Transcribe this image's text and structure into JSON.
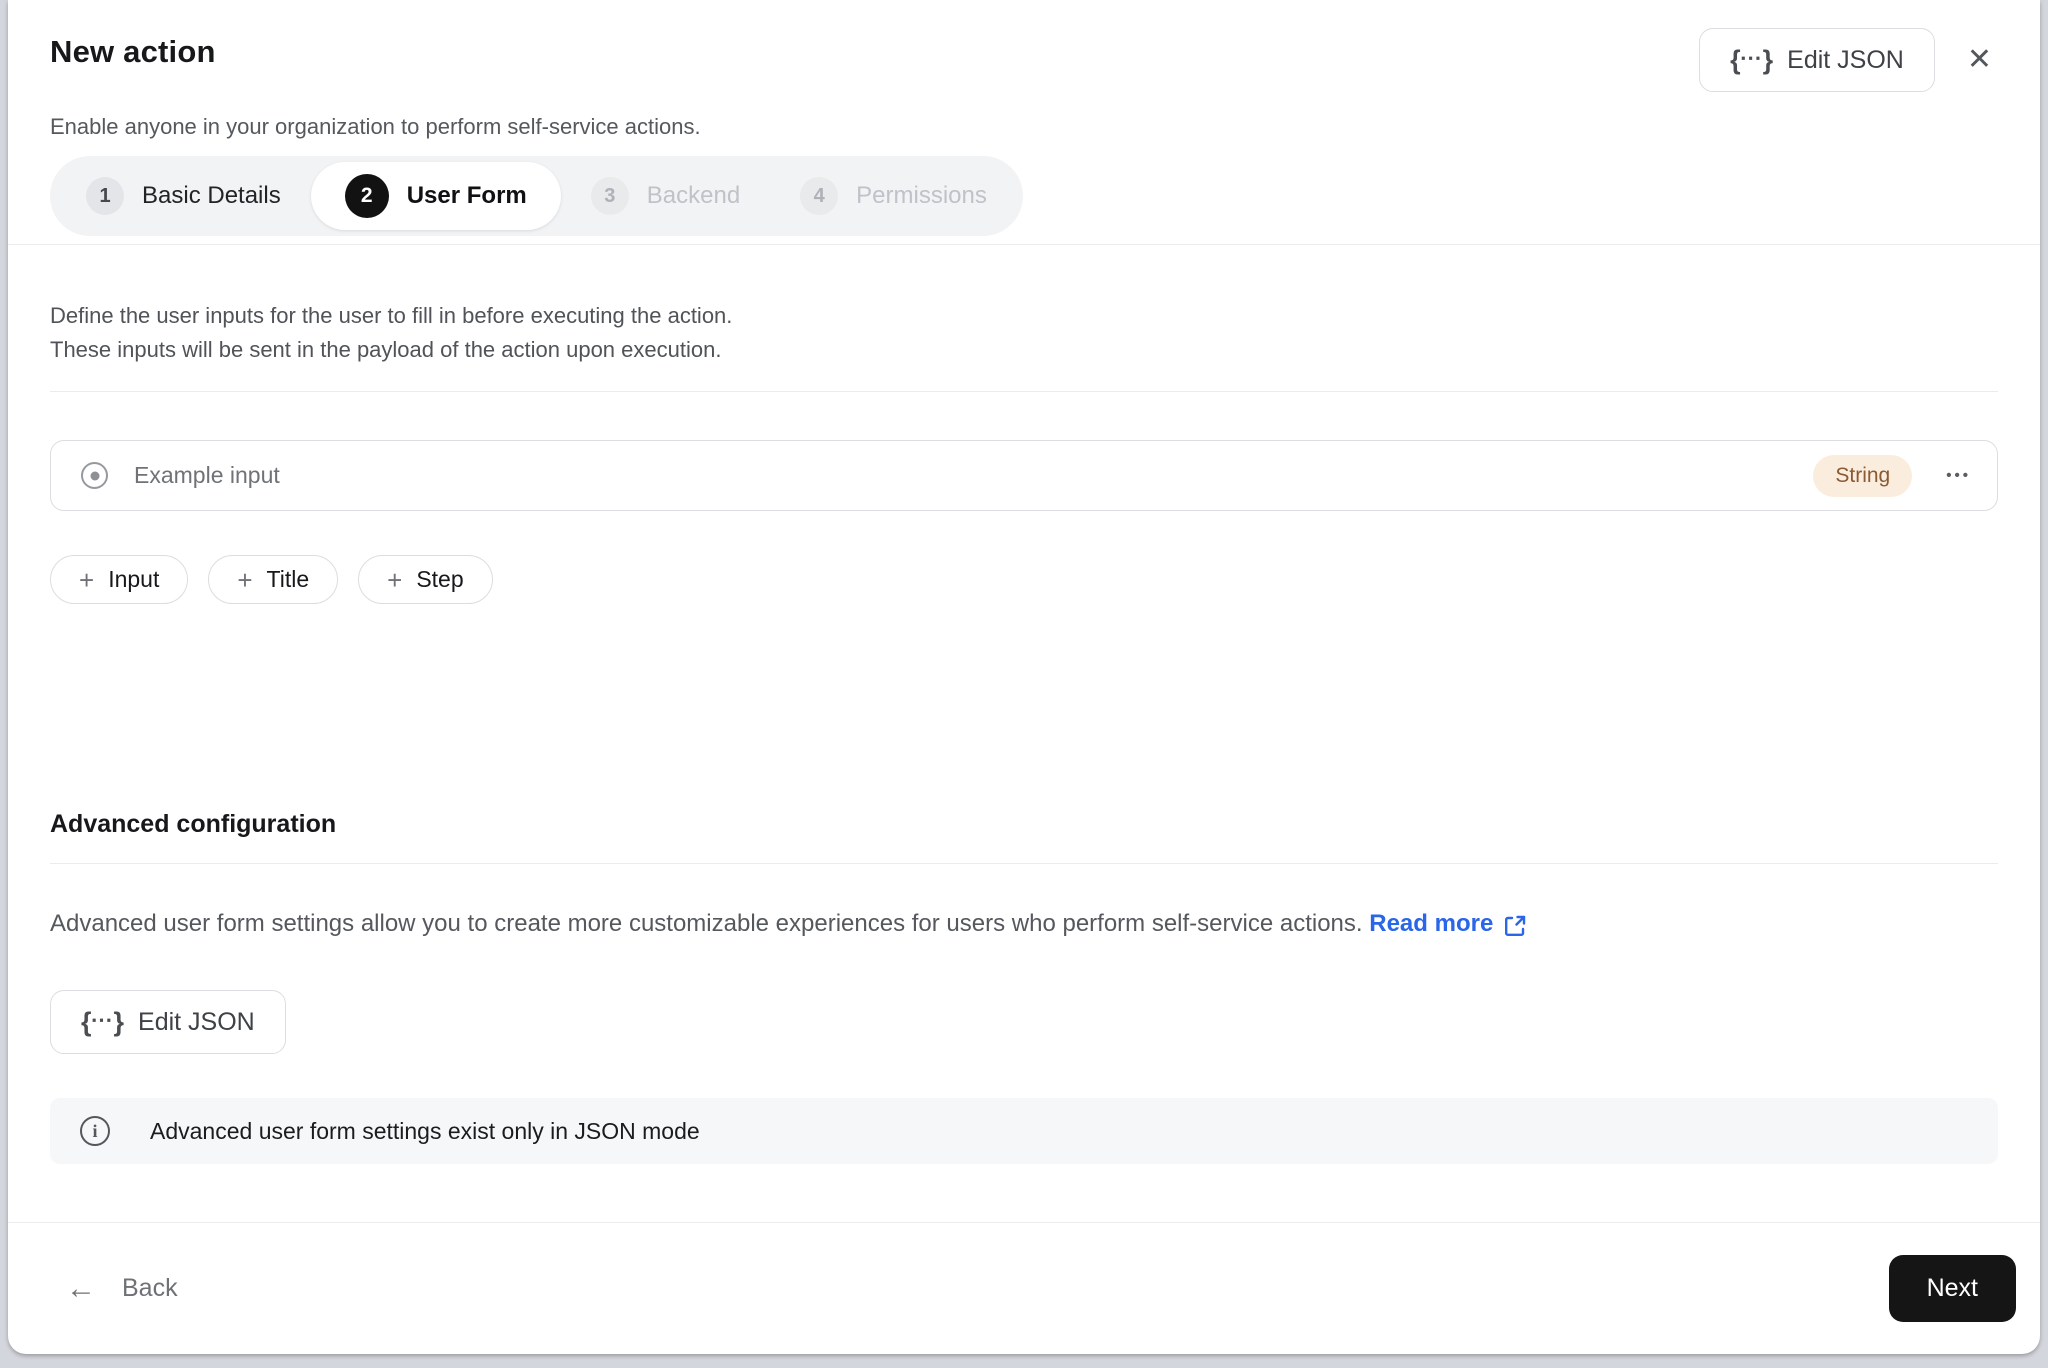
{
  "modal": {
    "title": "New action",
    "subtitle": "Enable anyone in your organization to perform self-service actions."
  },
  "header_actions": {
    "edit_json_label": "Edit JSON"
  },
  "stepper": {
    "steps": [
      {
        "number": "1",
        "label": "Basic Details",
        "state": "done"
      },
      {
        "number": "2",
        "label": "User Form",
        "state": "active"
      },
      {
        "number": "3",
        "label": "Backend",
        "state": "upcoming"
      },
      {
        "number": "4",
        "label": "Permissions",
        "state": "upcoming"
      }
    ]
  },
  "form_section": {
    "description_line1": "Define the user inputs for the user to fill in before executing the action.",
    "description_line2": "These inputs will be sent in the payload of the action upon execution.",
    "input_row": {
      "label": "Example input",
      "type_badge": "String"
    },
    "add_buttons": [
      {
        "label": "Input"
      },
      {
        "label": "Title"
      },
      {
        "label": "Step"
      }
    ]
  },
  "advanced": {
    "heading": "Advanced configuration",
    "description": "Advanced user form settings allow you to create more customizable experiences for users who perform self-service actions.",
    "read_more_label": "Read more",
    "edit_json_label": "Edit JSON",
    "info_banner": "Advanced user form settings exist only in JSON mode"
  },
  "footer": {
    "back_label": "Back",
    "next_label": "Next"
  },
  "icons": {
    "plus": "+",
    "ellipsis": "•••",
    "close": "✕",
    "back_arrow": "←",
    "info": "i",
    "brace_left": "{",
    "brace_dots": "⋯",
    "brace_right": "}"
  },
  "colors": {
    "accent_blue": "#2a66e8",
    "badge_bg": "#fbeddd",
    "badge_text": "#8a5a33",
    "active_step_bg": "#121212",
    "next_button_bg": "#151515"
  }
}
